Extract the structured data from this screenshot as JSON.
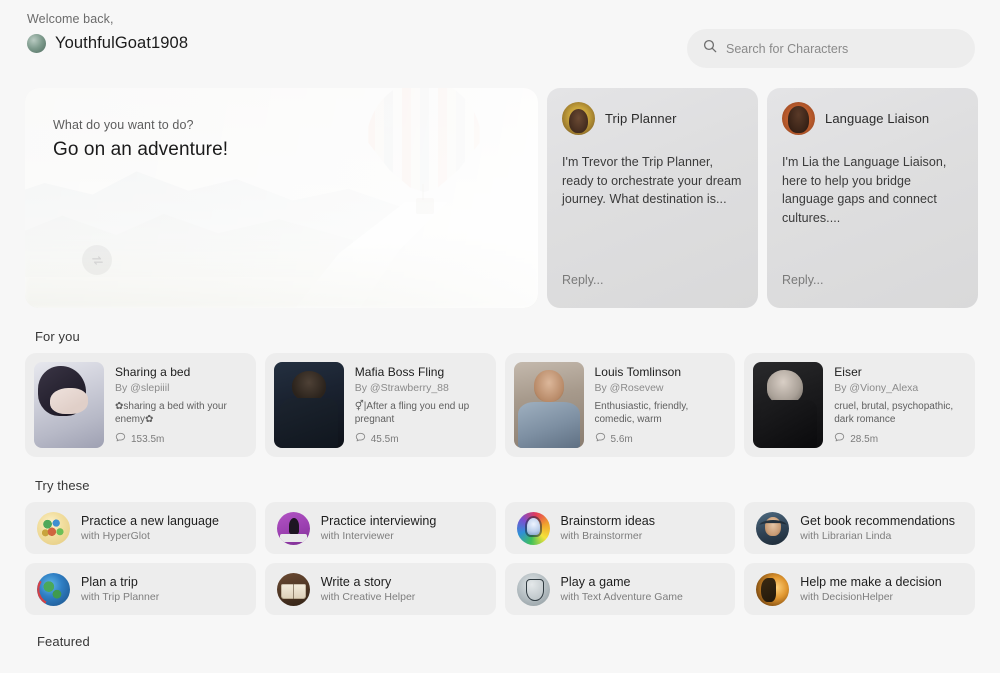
{
  "header": {
    "welcome_label": "Welcome back,",
    "username": "YouthfulGoat1908",
    "avatar_icon": "user-avatar"
  },
  "search": {
    "placeholder": "Search for Characters",
    "value": "",
    "icon": "search-icon"
  },
  "hero": {
    "kicker": "What do you want to do?",
    "title": "Go on an adventure!",
    "shuffle_icon": "refresh-shuffle-icon",
    "image_alt": "hot-air-balloon-over-misty-valley"
  },
  "character_previews": [
    {
      "name": "Trip Planner",
      "avatar_icon": "trip-planner-avatar",
      "message": "I'm Trevor the Trip Planner, ready to orchestrate your dream journey. What destination is...",
      "reply_placeholder": "Reply..."
    },
    {
      "name": "Language Liaison",
      "avatar_icon": "language-liaison-avatar",
      "message": "I'm Lia the Language Liaison, here to help you bridge language gaps and connect cultures....",
      "reply_placeholder": "Reply..."
    }
  ],
  "for_you": {
    "title": "For you",
    "cards": [
      {
        "title": "Sharing a bed",
        "author": "By @slepiiil",
        "description": "✿sharing a bed with your enemy✿",
        "stat": "153.5m",
        "stat_icon": "chat-bubble-icon",
        "thumb_class": "th-bed",
        "thumb_alt": "anime-character-lying-in-bed"
      },
      {
        "title": "Mafia Boss Fling",
        "author": "By @Strawberry_88",
        "description": "⚥|After a fling you end up pregnant",
        "stat": "45.5m",
        "stat_icon": "chat-bubble-icon",
        "thumb_class": "th-mafia",
        "thumb_alt": "man-in-dark-suit-in-car"
      },
      {
        "title": "Louis Tomlinson",
        "author": "By @Rosevew",
        "description": "Enthusiastic, friendly, comedic, warm",
        "stat": "5.6m",
        "stat_icon": "chat-bubble-icon",
        "thumb_class": "th-louis",
        "thumb_alt": "young-man-in-denim-jacket"
      },
      {
        "title": "Eiser",
        "author": "By @Viony_Alexa",
        "description": "cruel, brutal, psychopathic, dark romance",
        "stat": "28.5m",
        "stat_icon": "chat-bubble-icon",
        "thumb_class": "th-eiser",
        "thumb_alt": "couple-embracing-dark-monochrome"
      }
    ]
  },
  "try_these": {
    "title": "Try these",
    "items": [
      {
        "label": "Practice a new language",
        "sub": "with HyperGlot",
        "icon": "globe-map-icon",
        "icon_class": "ic-globe"
      },
      {
        "label": "Practice interviewing",
        "sub": "with Interviewer",
        "icon": "interviewer-icon",
        "icon_class": "ic-interview"
      },
      {
        "label": "Brainstorm ideas",
        "sub": "with Brainstormer",
        "icon": "lightbulb-icon",
        "icon_class": "ic-brainstorm"
      },
      {
        "label": "Get book recommendations",
        "sub": "with Librarian Linda",
        "icon": "librarian-icon",
        "icon_class": "ic-librarian"
      },
      {
        "label": "Plan a trip",
        "sub": "with Trip Planner",
        "icon": "globe-trip-icon",
        "icon_class": "ic-trip"
      },
      {
        "label": "Write a story",
        "sub": "with Creative Helper",
        "icon": "open-book-icon",
        "icon_class": "ic-story"
      },
      {
        "label": "Play a game",
        "sub": "with Text Adventure Game",
        "icon": "shield-icon",
        "icon_class": "ic-game"
      },
      {
        "label": "Help me make a decision",
        "sub": "with DecisionHelper",
        "icon": "profile-silhouette-icon",
        "icon_class": "ic-decision"
      }
    ]
  },
  "featured": {
    "title": "Featured"
  },
  "colors": {
    "page_background": "#f7f7f7",
    "card_background": "#ededed",
    "preview_card_background": "#e0e0e2",
    "text_primary": "#1d1d1d",
    "text_secondary": "#7e7e7e"
  }
}
